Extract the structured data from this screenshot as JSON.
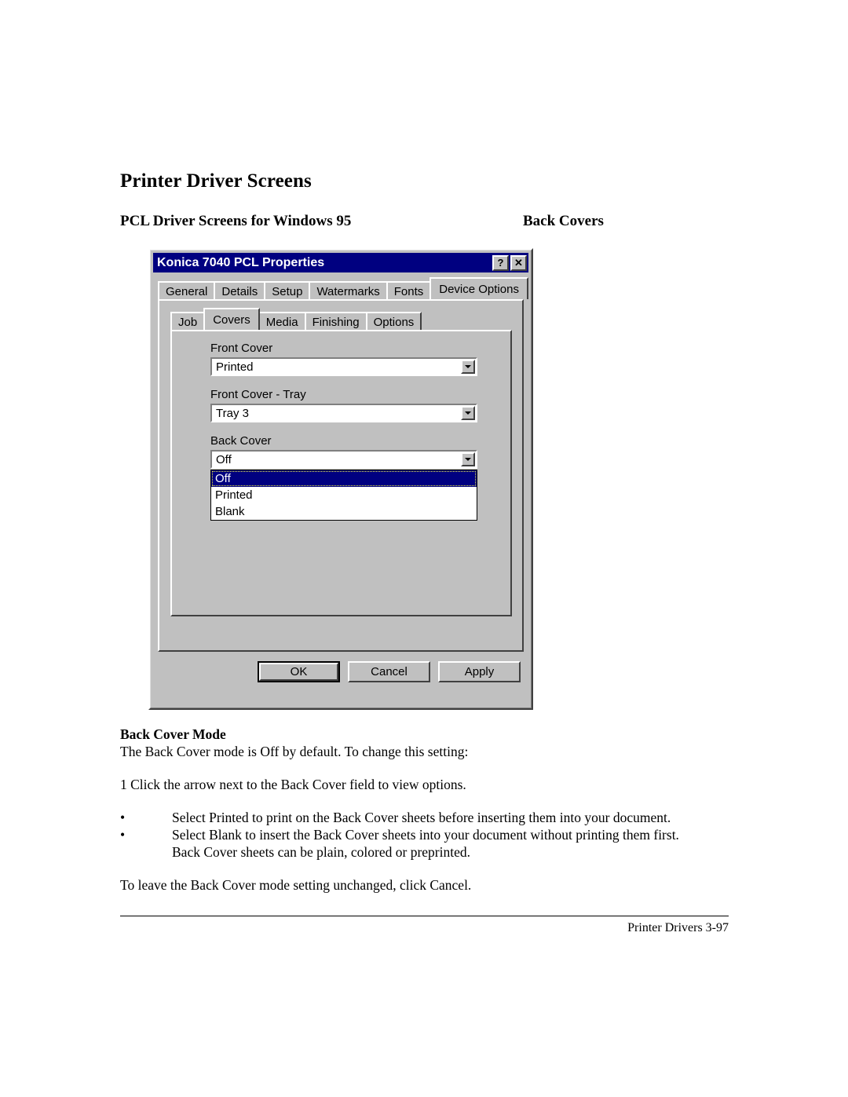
{
  "document": {
    "page_title": "Printer Driver Screens",
    "sub_head_left": "PCL Driver Screens for Windows 95",
    "sub_head_right": "Back Covers",
    "section_heading": "Back Cover Mode",
    "intro_line": "The Back Cover mode is Off by default. To change this setting:",
    "step_1": "1 Click the arrow next to the Back Cover field to view options.",
    "bullets": [
      {
        "marker": "•",
        "line1": "Select Printed to print on the Back Cover sheets before inserting them into your document.",
        "line2": ""
      },
      {
        "marker": "•",
        "line1": "Select Blank to insert the Back Cover sheets into your document without printing them first.",
        "line2": "Back Cover sheets can be plain, colored or preprinted."
      }
    ],
    "closing_line": "To leave the Back Cover mode setting unchanged, click Cancel.",
    "footer": "Printer Drivers 3-97"
  },
  "dialog": {
    "title": "Konica 7040 PCL Properties",
    "help_button": "?",
    "close_button": "✕",
    "outer_tabs": [
      {
        "label": "General",
        "active": false
      },
      {
        "label": "Details",
        "active": false
      },
      {
        "label": "Setup",
        "active": false
      },
      {
        "label": "Watermarks",
        "active": false
      },
      {
        "label": "Fonts",
        "active": false
      },
      {
        "label": "Device Options",
        "active": true
      }
    ],
    "inner_tabs": [
      {
        "label": "Job",
        "active": false
      },
      {
        "label": "Covers",
        "active": true
      },
      {
        "label": "Media",
        "active": false
      },
      {
        "label": "Finishing",
        "active": false
      },
      {
        "label": "Options",
        "active": false
      }
    ],
    "fields": {
      "front_cover": {
        "label": "Front Cover",
        "value": "Printed"
      },
      "front_cover_tray": {
        "label": "Front Cover - Tray",
        "value": "Tray 3"
      },
      "back_cover": {
        "label": "Back Cover",
        "value": "Off",
        "open": true,
        "options": [
          "Off",
          "Printed",
          "Blank"
        ],
        "selected_index": 0
      }
    },
    "buttons": {
      "ok": "OK",
      "cancel": "Cancel",
      "apply": "Apply"
    },
    "colors": {
      "face": "#c0c0c0",
      "titlebar": "#000080",
      "highlight": "#000080",
      "focus_dots": "#e8e840"
    }
  }
}
